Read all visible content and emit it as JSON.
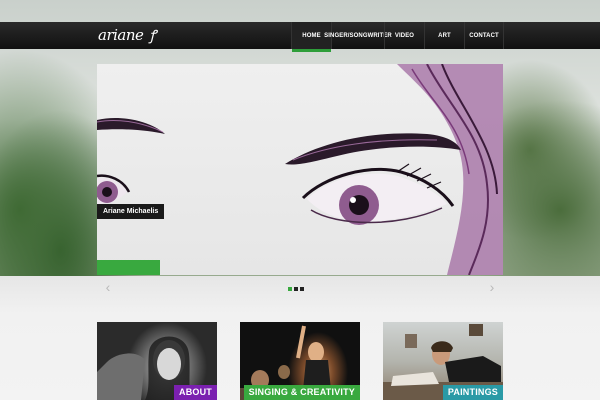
{
  "header": {
    "logo_text": "ariane",
    "logo_mark": "ꝭ",
    "nav": [
      {
        "label": "HOME",
        "active": true
      },
      {
        "label": "SINGER/SONGWRITER",
        "active": false
      },
      {
        "label": "VIDEO",
        "active": false
      },
      {
        "label": "ART",
        "active": false
      },
      {
        "label": "CONTACT",
        "active": false
      }
    ]
  },
  "slider": {
    "caption": "Ariane Michaelis",
    "current_slide": 1,
    "slide_count": 3,
    "prev_icon": "chevron-left-icon",
    "next_icon": "chevron-right-icon"
  },
  "tiles": [
    {
      "label": "ABOUT",
      "color": "#7b20b0"
    },
    {
      "label": "SINGING & CREATIVITY",
      "color": "#39a93f"
    },
    {
      "label": "PAINTINGS",
      "color": "#2a9aa6"
    }
  ],
  "colors": {
    "accent": "#39a93f",
    "nav_bg": "#111111"
  }
}
